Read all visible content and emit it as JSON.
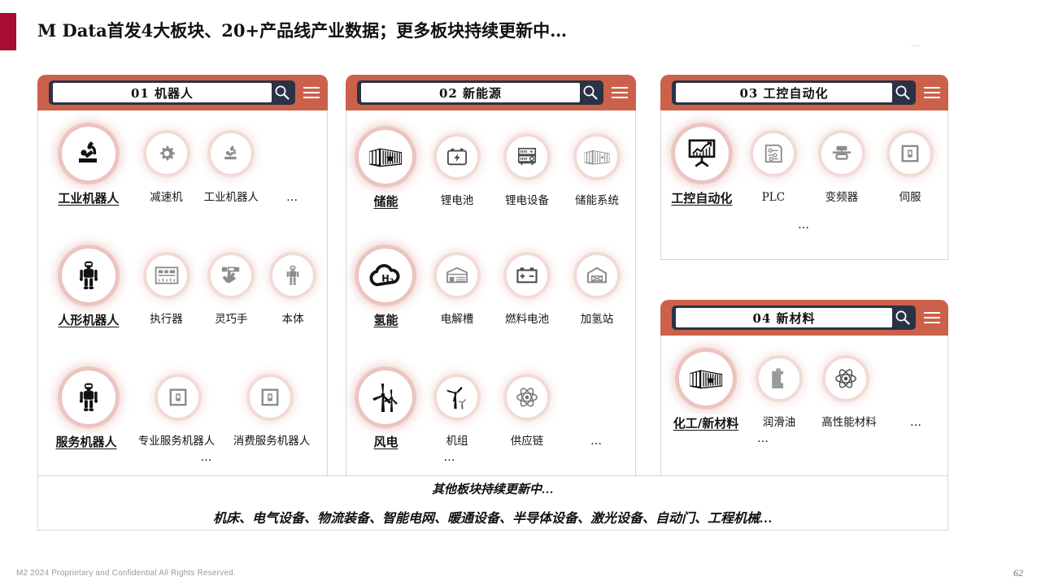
{
  "header": {
    "title": "M Data首发4大板块、20+产品线产业数据；更多板块持续更新中…",
    "accent_color": "#a80c30"
  },
  "theme": {
    "header_bar": "#cc614b",
    "search_box": "#2b3245",
    "card_border": "#d6d6d6",
    "glow": "#d68276"
  },
  "cards": [
    {
      "id": "01",
      "number": "01",
      "name": "机器人",
      "search_value": "01 机器人",
      "search_icon": "search-icon",
      "menu_icon": "hamburger-menu-icon",
      "rows": [
        {
          "main": {
            "label": "工业机器人",
            "icon": "industrial-robot-arm-icon"
          },
          "subs": [
            {
              "label": "减速机",
              "icon": "gear-icon"
            },
            {
              "label": "工业机器人",
              "icon": "industrial-robot-arm-icon"
            },
            {
              "label": "…",
              "icon": "none"
            }
          ],
          "ellipsis": ""
        },
        {
          "main": {
            "label": "人形机器人",
            "icon": "humanoid-robot-icon"
          },
          "subs": [
            {
              "label": "执行器",
              "icon": "actuator-panel-icon"
            },
            {
              "label": "灵巧手",
              "icon": "dexterous-hand-icon"
            },
            {
              "label": "本体",
              "icon": "humanoid-robot-icon"
            }
          ],
          "ellipsis": ""
        },
        {
          "main": {
            "label": "服务机器人",
            "icon": "humanoid-robot-icon"
          },
          "subs": [
            {
              "label": "专业服务机器人",
              "icon": "device-square-icon"
            },
            {
              "label": "消费服务机器人",
              "icon": "device-square-icon"
            }
          ],
          "ellipsis": "…"
        }
      ]
    },
    {
      "id": "02",
      "number": "02",
      "name": "新能源",
      "search_value": "02 新能源",
      "search_icon": "search-icon",
      "menu_icon": "hamburger-menu-icon",
      "rows": [
        {
          "main": {
            "label": "储能",
            "icon": "energy-storage-container-icon"
          },
          "subs": [
            {
              "label": "锂电池",
              "icon": "battery-bolt-icon"
            },
            {
              "label": "锂电设备",
              "icon": "battery-equipment-rack-icon"
            },
            {
              "label": "储能系统",
              "icon": "energy-storage-container-icon"
            }
          ],
          "ellipsis": ""
        },
        {
          "main": {
            "label": "氢能",
            "icon": "hydrogen-cloud-icon"
          },
          "subs": [
            {
              "label": "电解槽",
              "icon": "electrolyzer-plant-icon"
            },
            {
              "label": "燃料电池",
              "icon": "fuel-cell-battery-icon"
            },
            {
              "label": "加氢站",
              "icon": "hydrogen-station-icon"
            }
          ],
          "ellipsis": ""
        },
        {
          "main": {
            "label": "风电",
            "icon": "wind-turbine-icon"
          },
          "subs": [
            {
              "label": "机组",
              "icon": "wind-turbine-single-icon"
            },
            {
              "label": "供应链",
              "icon": "atom-icon"
            },
            {
              "label": "…",
              "icon": "none"
            }
          ],
          "ellipsis": "…"
        }
      ]
    },
    {
      "id": "03",
      "number": "03",
      "name": "工控自动化",
      "search_value": "03 工控自动化",
      "search_icon": "search-icon",
      "menu_icon": "hamburger-menu-icon",
      "rows": [
        {
          "main": {
            "label": "工控自动化",
            "icon": "presentation-chart-icon"
          },
          "subs": [
            {
              "label": "PLC",
              "icon": "plc-controller-icon"
            },
            {
              "label": "变频器",
              "icon": "inverter-icon"
            },
            {
              "label": "伺服",
              "icon": "device-square-icon"
            }
          ],
          "ellipsis": "…"
        }
      ]
    },
    {
      "id": "04",
      "number": "04",
      "name": "新材料",
      "search_value": "04 新材料",
      "search_icon": "search-icon",
      "menu_icon": "hamburger-menu-icon",
      "rows": [
        {
          "main": {
            "label": "化工/新材料",
            "icon": "chemical-plant-container-icon"
          },
          "subs": [
            {
              "label": "润滑油",
              "icon": "oil-canister-icon"
            },
            {
              "label": "高性能材料",
              "icon": "atom-icon"
            },
            {
              "label": "…",
              "icon": "none"
            }
          ],
          "ellipsis": "…"
        }
      ]
    }
  ],
  "banner": {
    "line1": "其他板块持续更新中…",
    "line2": "机床、电气设备、物流装备、智能电网、暖通设备、半导体设备、激光设备、自动门、工程机械…"
  },
  "footer": {
    "copyright": "M2  2024 Proprietary and Confidential All Rights Reserved.",
    "page_number": "62"
  }
}
